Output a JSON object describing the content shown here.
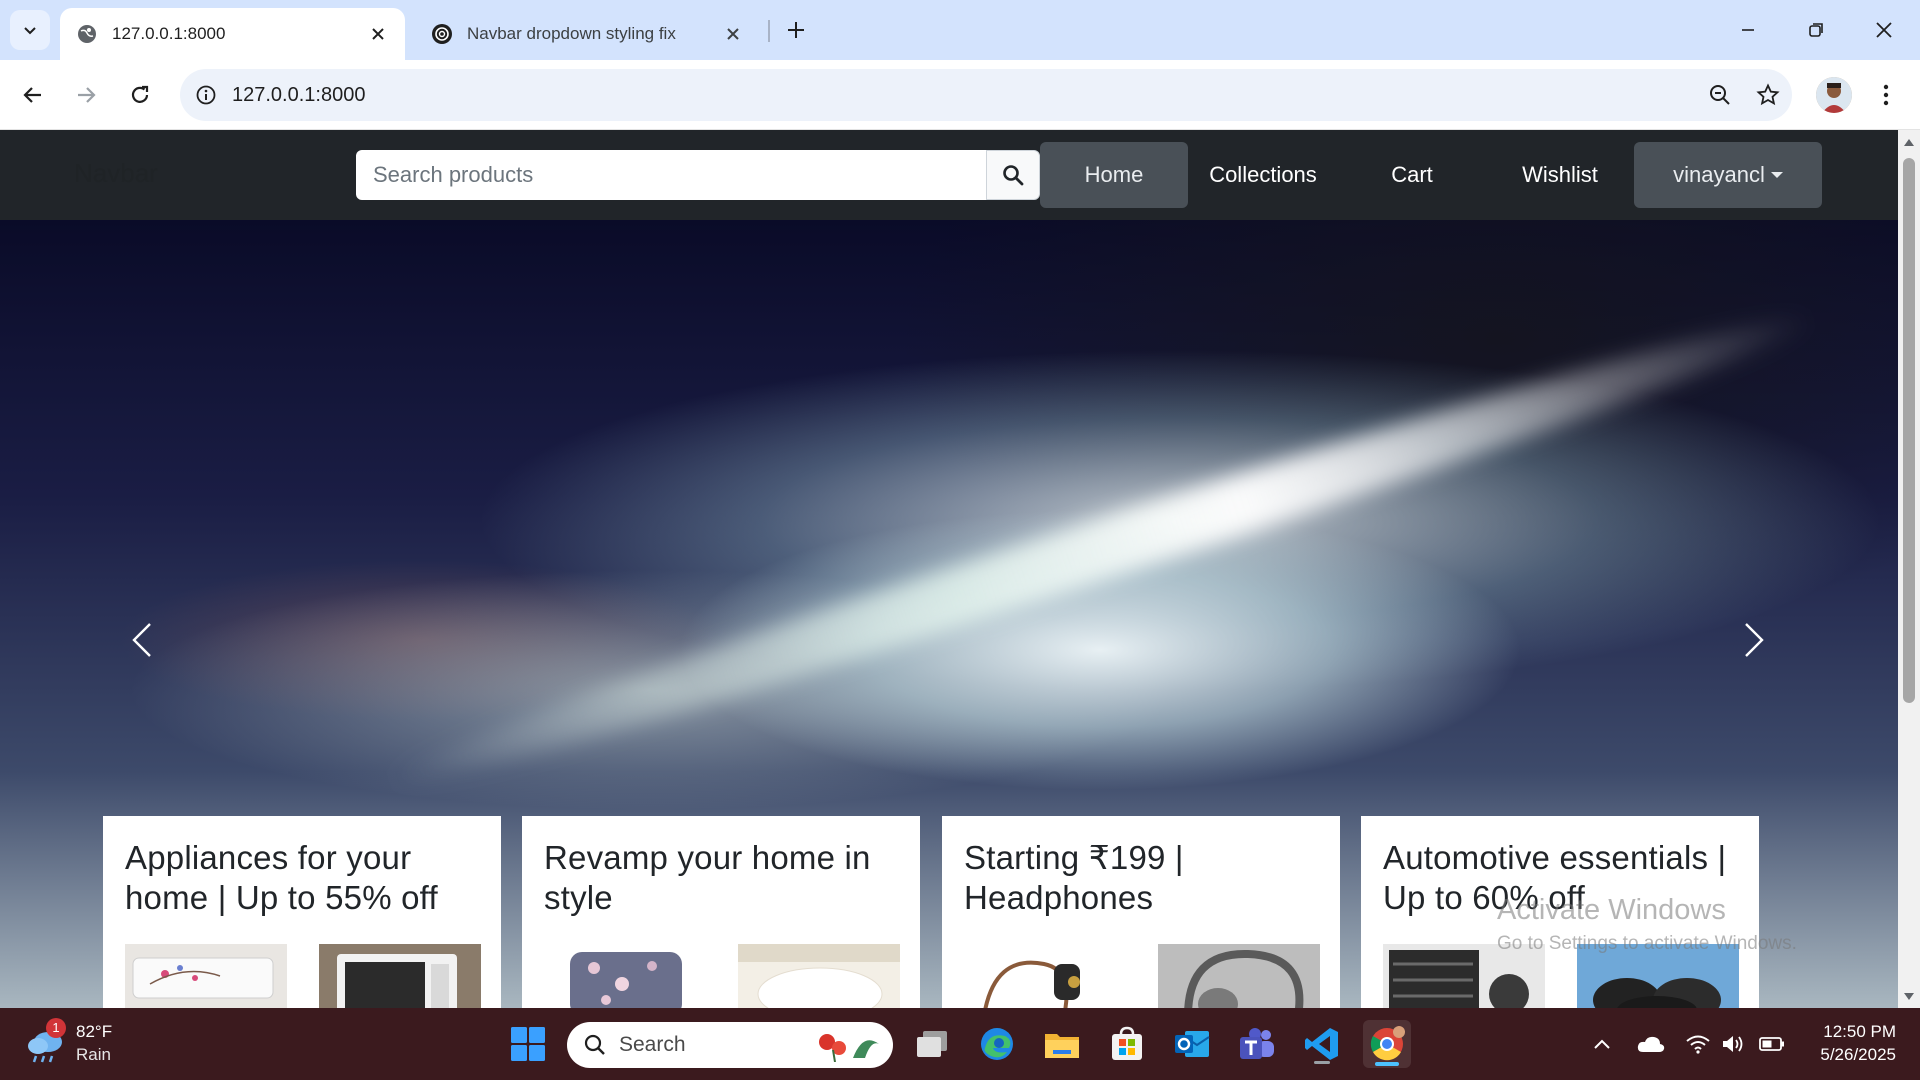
{
  "browser": {
    "tabs": [
      {
        "title": "127.0.0.1:8000",
        "active": true
      },
      {
        "title": "Navbar dropdown styling fix",
        "active": false
      }
    ],
    "url": "127.0.0.1:8000"
  },
  "page": {
    "navbar": {
      "brand": "Navbar",
      "search_placeholder": "Search products",
      "links": [
        "Home",
        "Collections",
        "Cart",
        "Wishlist"
      ],
      "user": "vinayancl"
    },
    "cards": [
      {
        "title": "Appliances for your home | Up to 55% off"
      },
      {
        "title": "Revamp your home in style"
      },
      {
        "title": "Starting ₹199 | Headphones"
      },
      {
        "title": "Automotive essentials | Up to 60% off"
      }
    ],
    "watermark": {
      "line1": "Activate Windows",
      "line2": "Go to Settings to activate Windows."
    }
  },
  "taskbar": {
    "weather": {
      "temp": "82°F",
      "condition": "Rain",
      "badge": "1"
    },
    "search_label": "Search",
    "time": "12:50 PM",
    "date": "5/26/2025"
  },
  "colors": {
    "tabstrip": "#d3e3fd",
    "navbar": "#212529",
    "active_nav": "#495057",
    "taskbar": "#3b1a1e"
  }
}
